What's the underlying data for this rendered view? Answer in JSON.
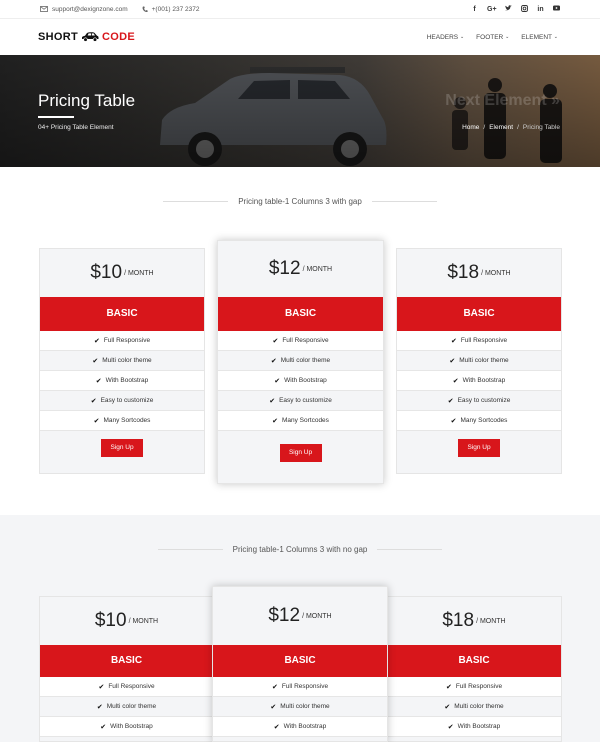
{
  "topbar": {
    "email": "support@dexignzone.com",
    "phone": "+(001) 237 2372",
    "social_icons": [
      "facebook-icon",
      "google-plus-icon",
      "twitter-icon",
      "instagram-icon",
      "linkedin-icon",
      "youtube-icon"
    ]
  },
  "header": {
    "logo_left": "SHORT",
    "logo_right": "CODE",
    "nav": [
      "HEADERS",
      "FOOTER",
      "ELEMENT"
    ]
  },
  "banner": {
    "title": "Pricing Table",
    "subtitle": "04+ Pricing Table Element",
    "next_label": "Next Element »",
    "breadcrumbs": [
      "Home",
      "Element",
      "Pricing Table"
    ]
  },
  "section1": {
    "title": "Pricing table-1 Columns 3 with gap",
    "cards": [
      {
        "price": "$10",
        "per": "/ MONTH",
        "plan": "BASIC",
        "features": [
          "Full Responsive",
          "Multi color theme",
          "With Bootstrap",
          "Easy to customize",
          "Many Sortcodes"
        ],
        "button": "Sign Up"
      },
      {
        "price": "$12",
        "per": "/ MONTH",
        "plan": "BASIC",
        "features": [
          "Full Responsive",
          "Multi color theme",
          "With Bootstrap",
          "Easy to customize",
          "Many Sortcodes"
        ],
        "button": "Sign Up"
      },
      {
        "price": "$18",
        "per": "/ MONTH",
        "plan": "BASIC",
        "features": [
          "Full Responsive",
          "Multi color theme",
          "With Bootstrap",
          "Easy to customize",
          "Many Sortcodes"
        ],
        "button": "Sign Up"
      }
    ]
  },
  "section2": {
    "title": "Pricing table-1 Columns 3 with no gap",
    "cards": [
      {
        "price": "$10",
        "per": "/ MONTH",
        "plan": "BASIC",
        "features": [
          "Full Responsive",
          "Multi color theme",
          "With Bootstrap"
        ]
      },
      {
        "price": "$12",
        "per": "/ MONTH",
        "plan": "BASIC",
        "features": [
          "Full Responsive",
          "Multi color theme",
          "With Bootstrap"
        ]
      },
      {
        "price": "$18",
        "per": "/ MONTH",
        "plan": "BASIC",
        "features": [
          "Full Responsive",
          "Multi color theme",
          "With Bootstrap"
        ]
      }
    ]
  },
  "colors": {
    "accent": "#d8161b",
    "panel": "#f4f5f7"
  }
}
